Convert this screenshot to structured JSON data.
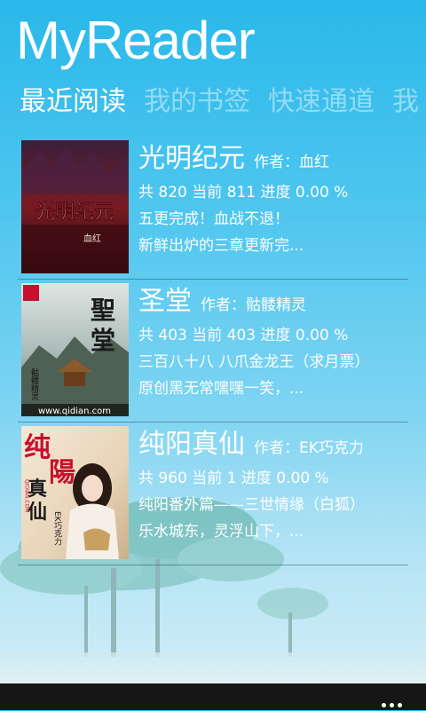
{
  "app": {
    "title": "MyReader"
  },
  "pivot": [
    {
      "label": "最近阅读"
    },
    {
      "label": "我的书签"
    },
    {
      "label": "快速通道"
    },
    {
      "label": "我"
    }
  ],
  "books": [
    {
      "title": "光明纪元",
      "author": "作者：血红",
      "progress": "共 820  当前 811  进度 0.00 %",
      "chapter": "五更完成！血战不退！",
      "excerpt": "新鲜出炉的三章更新完...",
      "cover_text": [
        "光明纪元",
        "血红"
      ]
    },
    {
      "title": "圣堂",
      "author": "作者：骷髅精灵",
      "progress": "共 403  当前 403  进度 0.00 %",
      "chapter": "三百八十八 八爪金龙王（求月票）",
      "excerpt": "原创黑无常嘿嘿一笑，...",
      "cover_text": [
        "聖",
        "堂",
        "骷髅精灵",
        "www.qidian.com"
      ]
    },
    {
      "title": "纯阳真仙",
      "author": "作者：EK巧克力",
      "progress": "共 960  当前 1  进度 0.00 %",
      "chapter": "纯阳番外篇——三世情缘（白狐）",
      "excerpt": "乐水城东，灵浮山下，...",
      "cover_text": [
        "纯",
        "陽",
        "真",
        "仙",
        "EK巧克力",
        "QIDIAN.COM"
      ]
    }
  ],
  "appbar": {
    "more_icon": "more-dots-icon"
  }
}
